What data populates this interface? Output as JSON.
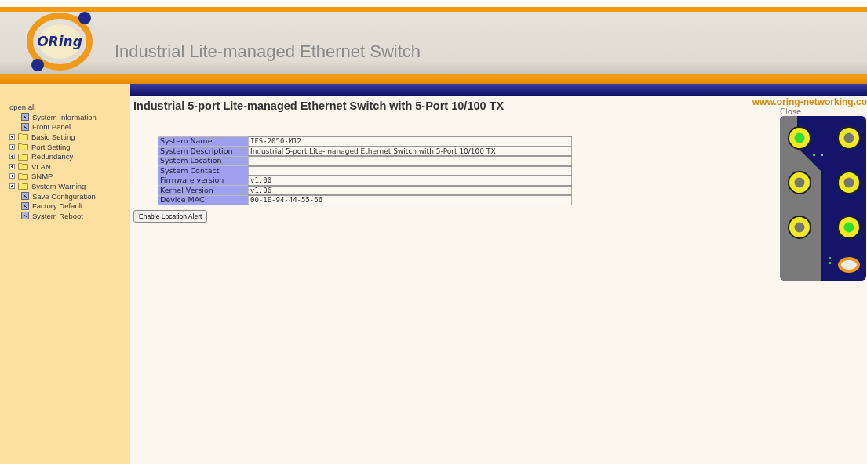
{
  "header": {
    "logo": "ORing",
    "title": "Industrial Lite-managed Ethernet Switch"
  },
  "sidebar": {
    "open_all": "open all",
    "items": [
      {
        "label": "System Information",
        "kind": "page"
      },
      {
        "label": "Front Panel",
        "kind": "page"
      },
      {
        "label": "Basic Setting",
        "kind": "folder"
      },
      {
        "label": "Port Setting",
        "kind": "folder"
      },
      {
        "label": "Redundancy",
        "kind": "folder"
      },
      {
        "label": "VLAN",
        "kind": "folder"
      },
      {
        "label": "SNMP",
        "kind": "folder"
      },
      {
        "label": "System Warning",
        "kind": "folder"
      },
      {
        "label": "Save Configuration",
        "kind": "page"
      },
      {
        "label": "Factory Default",
        "kind": "page"
      },
      {
        "label": "System Reboot",
        "kind": "page"
      }
    ]
  },
  "banner_url": "www.oring-networking.co",
  "page_title": "Industrial 5-port Lite-managed Ethernet Switch with 5-Port 10/100 TX",
  "info_table": [
    {
      "label": "System Name",
      "value": "IES-2050-M12"
    },
    {
      "label": "System Description",
      "value": "Industrial 5-port Lite-managed Ethernet Switch with 5-Port 10/100 TX"
    },
    {
      "label": "System Location"
    },
    {
      "label": "System Contact"
    },
    {
      "label": "Firmware version",
      "value": "v1.00"
    },
    {
      "label": "Kernel Version",
      "value": "v1.06"
    },
    {
      "label": "Device MAC",
      "value": "00-1E-94-44-55-66"
    }
  ],
  "button": "Enable Location Alert",
  "front_panel": {
    "close": "Close"
  }
}
